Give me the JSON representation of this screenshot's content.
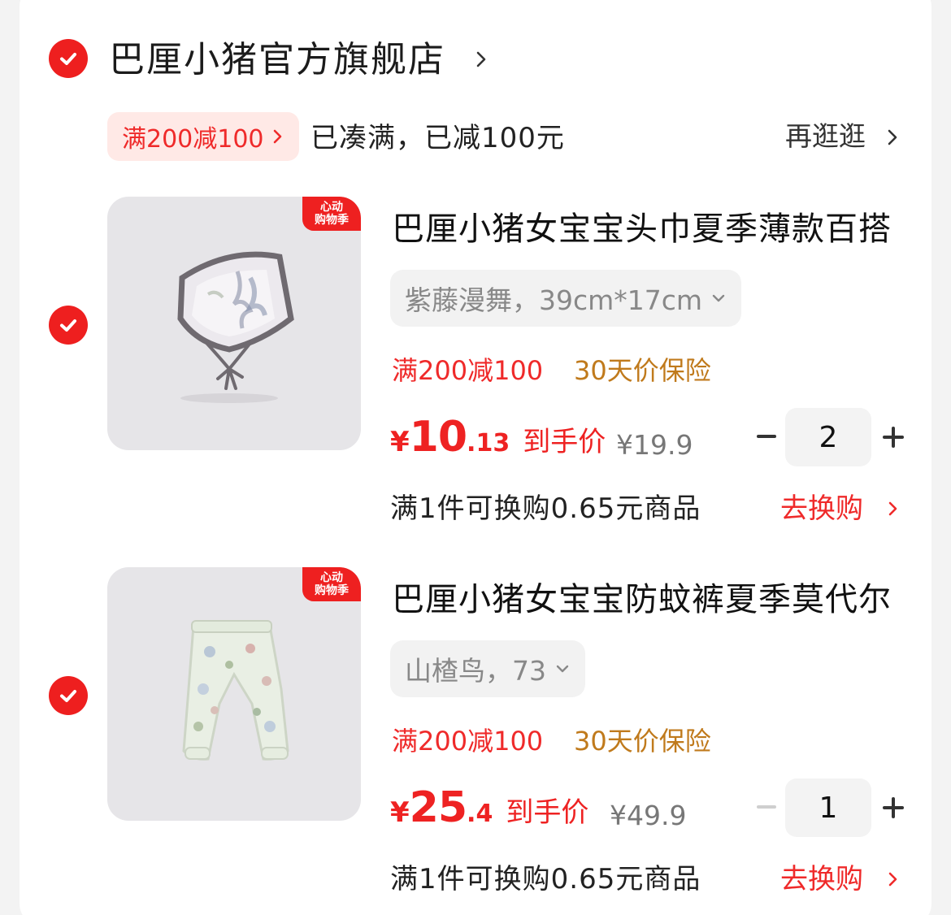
{
  "colors": {
    "accent": "#ee1f1f",
    "orange_tag": "#c07a1c",
    "muted": "#888888"
  },
  "shop": {
    "name": "巴厘小猪官方旗舰店",
    "check_icon": "checkmark-circle-icon",
    "chevron_icon": "chevron-right-icon"
  },
  "promo": {
    "tag": "满200减100",
    "status": "已凑满，已减100元",
    "browse": "再逛逛"
  },
  "items": [
    {
      "badge_line1": "心动",
      "badge_line2": "购物季",
      "title": "巴厘小猪女宝宝头巾夏季薄款百搭",
      "sku": "紫藤漫舞，39cm*17cm",
      "promo_tag": "满200减100",
      "protect_tag": "30天价保险",
      "price_currency": "¥",
      "price_int": "10",
      "price_dec": ".13",
      "price_label": "到手价",
      "original_price": "¥19.9",
      "quantity": "2",
      "swap_text": "满1件可换购0.65元商品",
      "swap_link": "去换购",
      "image_icon": "baby-headscarf-image"
    },
    {
      "badge_line1": "心动",
      "badge_line2": "购物季",
      "title": "巴厘小猪女宝宝防蚊裤夏季莫代尔",
      "sku": "山楂鸟，73",
      "promo_tag": "满200减100",
      "protect_tag": "30天价保险",
      "price_currency": "¥",
      "price_int": "25",
      "price_dec": ".4",
      "price_label": "到手价",
      "original_price": "¥49.9",
      "quantity": "1",
      "swap_text": "满1件可换购0.65元商品",
      "swap_link": "去换购",
      "image_icon": "baby-pants-image"
    }
  ]
}
